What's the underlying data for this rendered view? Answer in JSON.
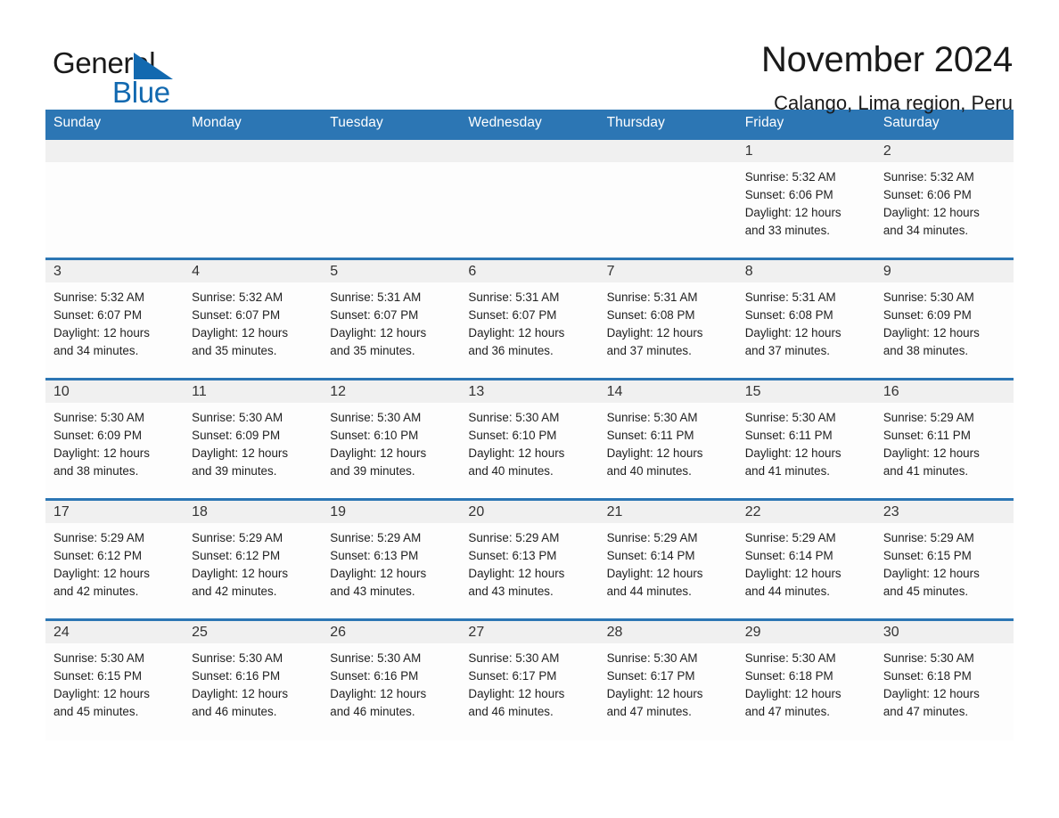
{
  "logo": {
    "word_one": "General",
    "word_two": "Blue",
    "triangle_color": "#1269b0",
    "icon": "triangle-icon"
  },
  "header": {
    "month_title": "November 2024",
    "location": "Calango, Lima region, Peru"
  },
  "theme": {
    "header_blue": "#2c76b4",
    "daynum_band": "#f0f0f0",
    "cell_background": "#fdfdfd",
    "page_background": "#ffffff"
  },
  "weekday_headers": [
    "Sunday",
    "Monday",
    "Tuesday",
    "Wednesday",
    "Thursday",
    "Friday",
    "Saturday"
  ],
  "weeks": [
    [
      {
        "day": "",
        "lines": []
      },
      {
        "day": "",
        "lines": []
      },
      {
        "day": "",
        "lines": []
      },
      {
        "day": "",
        "lines": []
      },
      {
        "day": "",
        "lines": []
      },
      {
        "day": "1",
        "lines": [
          "Sunrise: 5:32 AM",
          "Sunset: 6:06 PM",
          "Daylight: 12 hours",
          "and 33 minutes."
        ]
      },
      {
        "day": "2",
        "lines": [
          "Sunrise: 5:32 AM",
          "Sunset: 6:06 PM",
          "Daylight: 12 hours",
          "and 34 minutes."
        ]
      }
    ],
    [
      {
        "day": "3",
        "lines": [
          "Sunrise: 5:32 AM",
          "Sunset: 6:07 PM",
          "Daylight: 12 hours",
          "and 34 minutes."
        ]
      },
      {
        "day": "4",
        "lines": [
          "Sunrise: 5:32 AM",
          "Sunset: 6:07 PM",
          "Daylight: 12 hours",
          "and 35 minutes."
        ]
      },
      {
        "day": "5",
        "lines": [
          "Sunrise: 5:31 AM",
          "Sunset: 6:07 PM",
          "Daylight: 12 hours",
          "and 35 minutes."
        ]
      },
      {
        "day": "6",
        "lines": [
          "Sunrise: 5:31 AM",
          "Sunset: 6:07 PM",
          "Daylight: 12 hours",
          "and 36 minutes."
        ]
      },
      {
        "day": "7",
        "lines": [
          "Sunrise: 5:31 AM",
          "Sunset: 6:08 PM",
          "Daylight: 12 hours",
          "and 37 minutes."
        ]
      },
      {
        "day": "8",
        "lines": [
          "Sunrise: 5:31 AM",
          "Sunset: 6:08 PM",
          "Daylight: 12 hours",
          "and 37 minutes."
        ]
      },
      {
        "day": "9",
        "lines": [
          "Sunrise: 5:30 AM",
          "Sunset: 6:09 PM",
          "Daylight: 12 hours",
          "and 38 minutes."
        ]
      }
    ],
    [
      {
        "day": "10",
        "lines": [
          "Sunrise: 5:30 AM",
          "Sunset: 6:09 PM",
          "Daylight: 12 hours",
          "and 38 minutes."
        ]
      },
      {
        "day": "11",
        "lines": [
          "Sunrise: 5:30 AM",
          "Sunset: 6:09 PM",
          "Daylight: 12 hours",
          "and 39 minutes."
        ]
      },
      {
        "day": "12",
        "lines": [
          "Sunrise: 5:30 AM",
          "Sunset: 6:10 PM",
          "Daylight: 12 hours",
          "and 39 minutes."
        ]
      },
      {
        "day": "13",
        "lines": [
          "Sunrise: 5:30 AM",
          "Sunset: 6:10 PM",
          "Daylight: 12 hours",
          "and 40 minutes."
        ]
      },
      {
        "day": "14",
        "lines": [
          "Sunrise: 5:30 AM",
          "Sunset: 6:11 PM",
          "Daylight: 12 hours",
          "and 40 minutes."
        ]
      },
      {
        "day": "15",
        "lines": [
          "Sunrise: 5:30 AM",
          "Sunset: 6:11 PM",
          "Daylight: 12 hours",
          "and 41 minutes."
        ]
      },
      {
        "day": "16",
        "lines": [
          "Sunrise: 5:29 AM",
          "Sunset: 6:11 PM",
          "Daylight: 12 hours",
          "and 41 minutes."
        ]
      }
    ],
    [
      {
        "day": "17",
        "lines": [
          "Sunrise: 5:29 AM",
          "Sunset: 6:12 PM",
          "Daylight: 12 hours",
          "and 42 minutes."
        ]
      },
      {
        "day": "18",
        "lines": [
          "Sunrise: 5:29 AM",
          "Sunset: 6:12 PM",
          "Daylight: 12 hours",
          "and 42 minutes."
        ]
      },
      {
        "day": "19",
        "lines": [
          "Sunrise: 5:29 AM",
          "Sunset: 6:13 PM",
          "Daylight: 12 hours",
          "and 43 minutes."
        ]
      },
      {
        "day": "20",
        "lines": [
          "Sunrise: 5:29 AM",
          "Sunset: 6:13 PM",
          "Daylight: 12 hours",
          "and 43 minutes."
        ]
      },
      {
        "day": "21",
        "lines": [
          "Sunrise: 5:29 AM",
          "Sunset: 6:14 PM",
          "Daylight: 12 hours",
          "and 44 minutes."
        ]
      },
      {
        "day": "22",
        "lines": [
          "Sunrise: 5:29 AM",
          "Sunset: 6:14 PM",
          "Daylight: 12 hours",
          "and 44 minutes."
        ]
      },
      {
        "day": "23",
        "lines": [
          "Sunrise: 5:29 AM",
          "Sunset: 6:15 PM",
          "Daylight: 12 hours",
          "and 45 minutes."
        ]
      }
    ],
    [
      {
        "day": "24",
        "lines": [
          "Sunrise: 5:30 AM",
          "Sunset: 6:15 PM",
          "Daylight: 12 hours",
          "and 45 minutes."
        ]
      },
      {
        "day": "25",
        "lines": [
          "Sunrise: 5:30 AM",
          "Sunset: 6:16 PM",
          "Daylight: 12 hours",
          "and 46 minutes."
        ]
      },
      {
        "day": "26",
        "lines": [
          "Sunrise: 5:30 AM",
          "Sunset: 6:16 PM",
          "Daylight: 12 hours",
          "and 46 minutes."
        ]
      },
      {
        "day": "27",
        "lines": [
          "Sunrise: 5:30 AM",
          "Sunset: 6:17 PM",
          "Daylight: 12 hours",
          "and 46 minutes."
        ]
      },
      {
        "day": "28",
        "lines": [
          "Sunrise: 5:30 AM",
          "Sunset: 6:17 PM",
          "Daylight: 12 hours",
          "and 47 minutes."
        ]
      },
      {
        "day": "29",
        "lines": [
          "Sunrise: 5:30 AM",
          "Sunset: 6:18 PM",
          "Daylight: 12 hours",
          "and 47 minutes."
        ]
      },
      {
        "day": "30",
        "lines": [
          "Sunrise: 5:30 AM",
          "Sunset: 6:18 PM",
          "Daylight: 12 hours",
          "and 47 minutes."
        ]
      }
    ]
  ]
}
